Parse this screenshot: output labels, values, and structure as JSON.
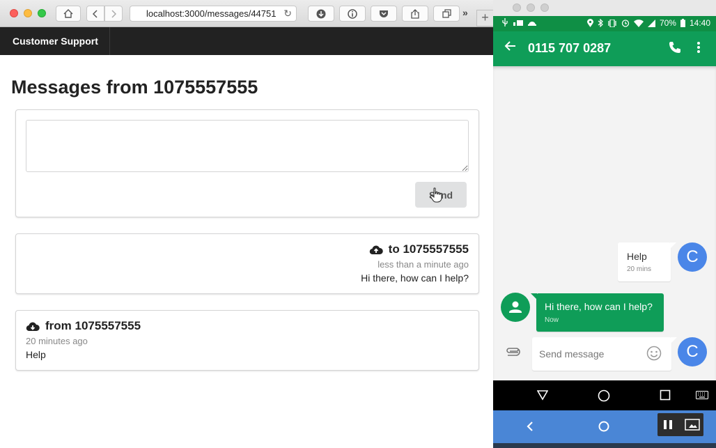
{
  "browser": {
    "url": "localhost:3000/messages/44751",
    "nav_brand": "Customer Support"
  },
  "page": {
    "title": "Messages from 1075557555",
    "send_label": "Send"
  },
  "messages": [
    {
      "direction": "to 1075557555",
      "time": "less than a minute ago",
      "body": "Hi there, how can I help?"
    },
    {
      "direction": "from 1075557555",
      "time": "20 minutes ago",
      "body": "Help"
    }
  ],
  "phone": {
    "battery": "70%",
    "clock": "14:40",
    "contact": "0115 707 0287",
    "bubble_out": {
      "text": "Help",
      "time": "20 mins"
    },
    "bubble_in": {
      "text": "Hi there, how can I help?",
      "time": "Now"
    },
    "avatar_letter": "C",
    "compose_placeholder": "Send message"
  },
  "colors": {
    "android_green": "#0f9d58",
    "avatar_blue": "#4a86e8",
    "navbar_dark": "#222222"
  }
}
